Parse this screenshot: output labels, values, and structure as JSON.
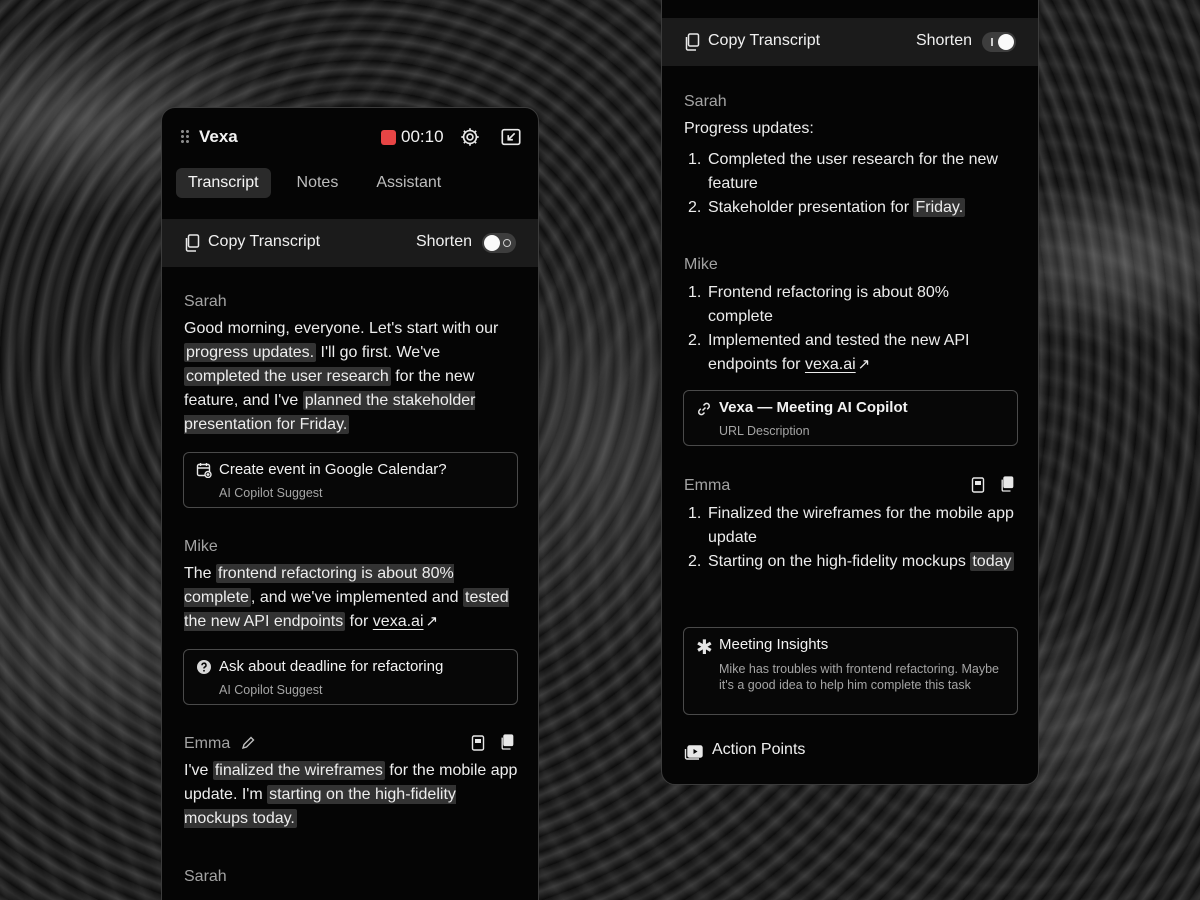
{
  "left_panel": {
    "app_title": "Vexa",
    "timer": "00:10",
    "tabs": [
      {
        "label": "Transcript",
        "active": true
      },
      {
        "label": "Notes",
        "active": false
      },
      {
        "label": "Assistant",
        "active": false
      }
    ],
    "toolbar": {
      "copy_label": "Copy Transcript",
      "shorten_label": "Shorten",
      "shorten_on": false
    },
    "blocks": {
      "sarah1": {
        "speaker": "Sarah",
        "t1": "Good morning, everyone. Let's start with our ",
        "h1": "progress updates.",
        "t2": " I'll go first. We've ",
        "h2": "completed the user research",
        "t3": " for the new feature, and I've ",
        "h3": "planned the stakeholder presentation for Friday."
      },
      "suggest1": {
        "title": "Create event in Google Calendar?",
        "sub": "AI Copilot Suggest",
        "icon": "calendar-icon"
      },
      "mike": {
        "speaker": "Mike",
        "t1": "The ",
        "h1": "frontend refactoring is about 80% complete",
        "t2": ", and we've implemented and ",
        "h2": "tested the new API endpoints",
        "t3": " for ",
        "link": "vexa.ai",
        "arrow": "↗"
      },
      "suggest2": {
        "title": "Ask about deadline for refactoring",
        "sub": "AI Copilot Suggest",
        "icon": "question-icon"
      },
      "emma": {
        "speaker": "Emma",
        "t1": "I've ",
        "h1": "finalized the wireframes",
        "t2": " for the mobile app update. I'm ",
        "h2": "starting on the high-fidelity mockups today."
      },
      "sarah2": {
        "speaker": "Sarah"
      }
    }
  },
  "right_panel": {
    "toolbar": {
      "copy_label": "Copy Transcript",
      "shorten_label": "Shorten",
      "shorten_on": true
    },
    "sarah": {
      "speaker": "Sarah",
      "intro": "Progress updates:",
      "items": [
        "Completed the user research for the new feature",
        "Stakeholder presentation for "
      ],
      "item2_highlight": "Friday."
    },
    "mike": {
      "speaker": "Mike",
      "items": [
        "Frontend refactoring is about 80% complete",
        "Implemented and tested the new API endpoints for "
      ],
      "link": "vexa.ai",
      "arrow": "↗"
    },
    "url_card": {
      "title": "Vexa — Meeting AI Copilot",
      "sub": "URL Description"
    },
    "emma": {
      "speaker": "Emma",
      "items": [
        "Finalized the wireframes for the mobile app update",
        "Starting on the high-fidelity mockups "
      ],
      "item2_highlight": "today"
    },
    "insights": {
      "title": "Meeting Insights",
      "body": "Mike has troubles with frontend refactoring. Maybe it's a good idea to help him complete this task"
    },
    "action_points": {
      "label": "Action Points"
    }
  },
  "colors": {
    "record": "#e84545",
    "panel_bg": "#050505",
    "toolbar_bg": "#1b1b1b",
    "highlight": "#333333"
  }
}
